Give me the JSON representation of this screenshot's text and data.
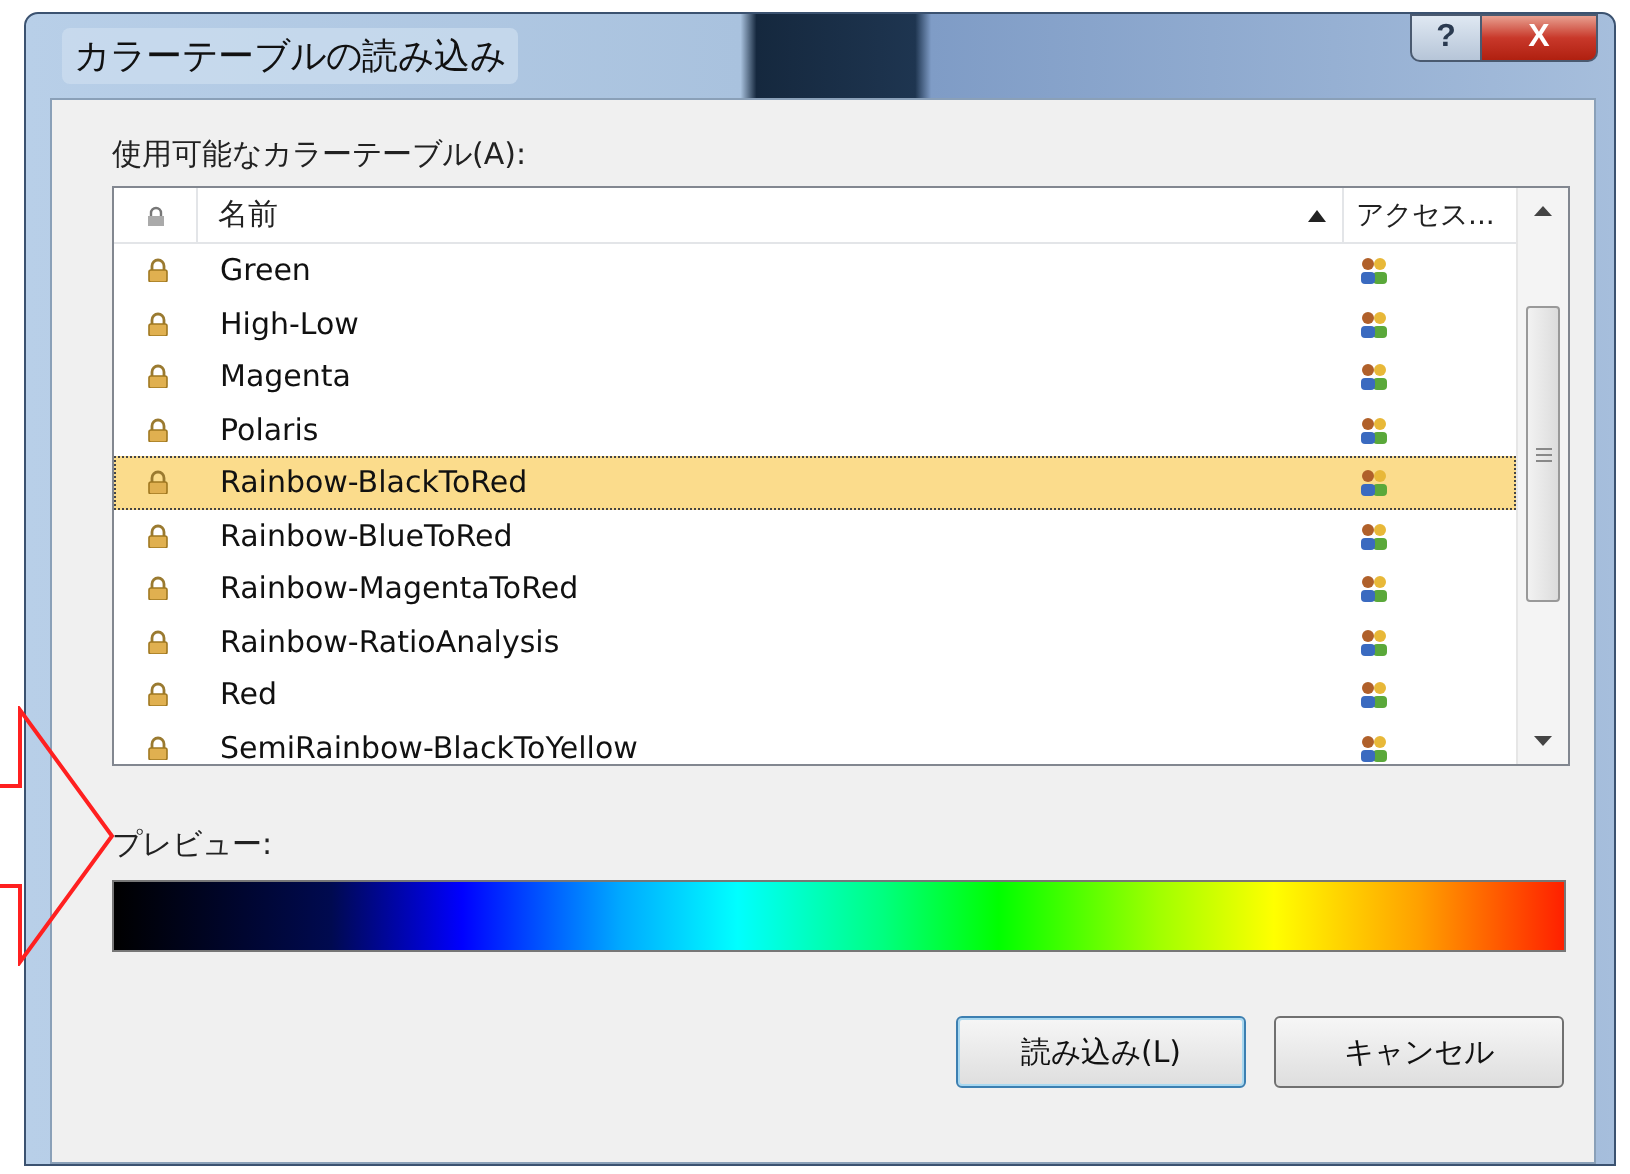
{
  "window": {
    "title": "カラーテーブルの読み込み",
    "help_button": "?",
    "close_button": "X"
  },
  "list_label": "使用可能なカラーテーブル(A):",
  "table": {
    "columns": [
      {
        "kind": "lock"
      },
      {
        "kind": "name",
        "label": "名前",
        "sorted": true
      },
      {
        "kind": "access",
        "label": "アクセス..."
      }
    ],
    "rows": [
      {
        "name": "Green",
        "selected": false
      },
      {
        "name": "High-Low",
        "selected": false
      },
      {
        "name": "Magenta",
        "selected": false
      },
      {
        "name": "Polaris",
        "selected": false
      },
      {
        "name": "Rainbow-BlackToRed",
        "selected": true
      },
      {
        "name": "Rainbow-BlueToRed",
        "selected": false
      },
      {
        "name": "Rainbow-MagentaToRed",
        "selected": false
      },
      {
        "name": "Rainbow-RatioAnalysis",
        "selected": false
      },
      {
        "name": "Red",
        "selected": false
      },
      {
        "name": "SemiRainbow-BlackToYellow",
        "selected": false
      }
    ]
  },
  "preview_label": "プレビュー:",
  "buttons": [
    {
      "label": "読み込み(L)",
      "default": true
    },
    {
      "label": "キャンセル",
      "default": false
    }
  ]
}
